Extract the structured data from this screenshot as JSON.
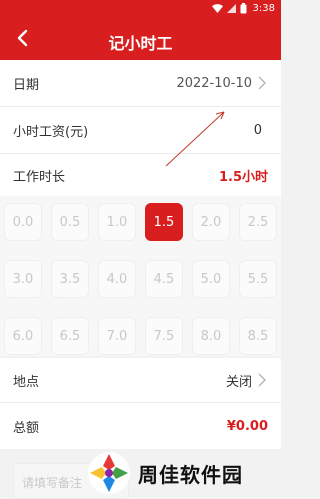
{
  "status": {
    "time": "3:38"
  },
  "header": {
    "title": "记小时工"
  },
  "date_row": {
    "label": "日期",
    "value": "2022-10-10"
  },
  "wage_row": {
    "label": "小时工资(元)",
    "value": "0"
  },
  "duration_row": {
    "label": "工作时长",
    "value": "1.5小时"
  },
  "hours": {
    "options": [
      "0.0",
      "0.5",
      "1.0",
      "1.5",
      "2.0",
      "2.5",
      "3.0",
      "3.5",
      "4.0",
      "4.5",
      "5.0",
      "5.5",
      "6.0",
      "6.5",
      "7.0",
      "7.5",
      "8.0",
      "8.5"
    ],
    "selected": "1.5"
  },
  "location_row": {
    "label": "地点",
    "value": "关闭"
  },
  "total_row": {
    "label": "总额",
    "value": "¥0.00"
  },
  "note": {
    "placeholder": "请填写备注"
  },
  "watermark": {
    "text": "周佳软件园"
  },
  "colors": {
    "accent": "#d81e1e"
  },
  "icons": [
    "wifi-icon",
    "signal-icon",
    "battery-icon",
    "back-arrow-icon",
    "chevron-right-icon"
  ]
}
